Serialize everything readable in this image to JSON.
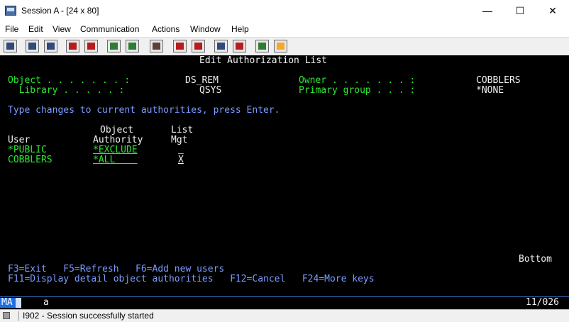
{
  "window": {
    "title": "Session A - [24 x 80]"
  },
  "menu": [
    "File",
    "Edit",
    "View",
    "Communication",
    "Actions",
    "Window",
    "Help"
  ],
  "screen": {
    "title": "Edit Authorization List",
    "object_label": "Object . . . . . . . :",
    "object_value": "DS_REM",
    "library_label": "  Library . . . . . :",
    "library_value": "QSYS",
    "owner_label": "Owner . . . . . . . :",
    "owner_value": "COBBLERS",
    "group_label": "Primary group . . . :",
    "group_value": "*NONE",
    "instruction": "Type changes to current authorities, press Enter.",
    "col_header_top_object": "Object",
    "col_header_top_list": "List",
    "col_user": "User",
    "col_authority": "Authority",
    "col_mgt": "Mgt",
    "rows": [
      {
        "user": "*PUBLIC",
        "authority": "*EXCLUDE",
        "mgt": " "
      },
      {
        "user": "COBBLERS",
        "authority": "*ALL    ",
        "mgt": "X"
      }
    ],
    "bottom": "Bottom",
    "fkeys_1": "F3=Exit   F5=Refresh   F6=Add new users",
    "fkeys_2": "F11=Display detail object authorities   F12=Cancel   F24=More keys"
  },
  "oia": {
    "mode": "MA",
    "session_letter": "a",
    "cursor_pos": "11/026"
  },
  "status": {
    "message": "I902 - Session successfully started"
  }
}
